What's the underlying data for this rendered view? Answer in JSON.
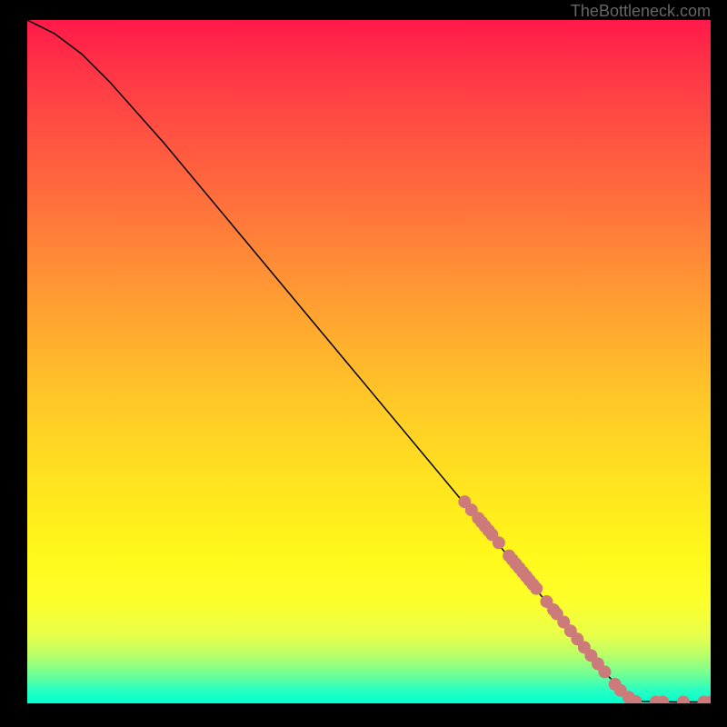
{
  "attribution": "TheBottleneck.com",
  "chart_data": {
    "type": "line",
    "title": "",
    "xlabel": "",
    "ylabel": "",
    "xlim": [
      0,
      100
    ],
    "ylim": [
      0,
      100
    ],
    "curve": [
      {
        "x": 0,
        "y": 100
      },
      {
        "x": 4,
        "y": 98
      },
      {
        "x": 8,
        "y": 95
      },
      {
        "x": 12,
        "y": 91
      },
      {
        "x": 20,
        "y": 82
      },
      {
        "x": 30,
        "y": 70
      },
      {
        "x": 40,
        "y": 58
      },
      {
        "x": 50,
        "y": 46
      },
      {
        "x": 60,
        "y": 34
      },
      {
        "x": 70,
        "y": 22
      },
      {
        "x": 80,
        "y": 10
      },
      {
        "x": 85,
        "y": 4
      },
      {
        "x": 88,
        "y": 1
      },
      {
        "x": 90,
        "y": 0.3
      },
      {
        "x": 95,
        "y": 0.2
      },
      {
        "x": 100,
        "y": 0.2
      }
    ],
    "dots": [
      {
        "x": 64,
        "y": 29.5
      },
      {
        "x": 65,
        "y": 28.3
      },
      {
        "x": 66,
        "y": 27.1
      },
      {
        "x": 66.5,
        "y": 26.5
      },
      {
        "x": 67,
        "y": 25.9
      },
      {
        "x": 67.5,
        "y": 25.3
      },
      {
        "x": 68,
        "y": 24.7
      },
      {
        "x": 69,
        "y": 23.5
      },
      {
        "x": 70.5,
        "y": 21.6
      },
      {
        "x": 71,
        "y": 21
      },
      {
        "x": 71.5,
        "y": 20.4
      },
      {
        "x": 72,
        "y": 19.8
      },
      {
        "x": 72.5,
        "y": 19.2
      },
      {
        "x": 73,
        "y": 18.6
      },
      {
        "x": 73.5,
        "y": 18
      },
      {
        "x": 74,
        "y": 17.4
      },
      {
        "x": 74.5,
        "y": 16.8
      },
      {
        "x": 76,
        "y": 14.9
      },
      {
        "x": 77,
        "y": 13.7
      },
      {
        "x": 77.5,
        "y": 13.1
      },
      {
        "x": 78.5,
        "y": 11.9
      },
      {
        "x": 79.5,
        "y": 10.6
      },
      {
        "x": 80.5,
        "y": 9.4
      },
      {
        "x": 81.5,
        "y": 8.2
      },
      {
        "x": 82.5,
        "y": 7
      },
      {
        "x": 83.5,
        "y": 5.8
      },
      {
        "x": 84.5,
        "y": 4.6
      },
      {
        "x": 86,
        "y": 2.8
      },
      {
        "x": 86.8,
        "y": 1.9
      },
      {
        "x": 88,
        "y": 0.9
      },
      {
        "x": 89,
        "y": 0.3
      },
      {
        "x": 92,
        "y": 0.2
      },
      {
        "x": 93,
        "y": 0.2
      },
      {
        "x": 96,
        "y": 0.2
      },
      {
        "x": 99,
        "y": 0.2
      },
      {
        "x": 100,
        "y": 0.2
      }
    ]
  }
}
